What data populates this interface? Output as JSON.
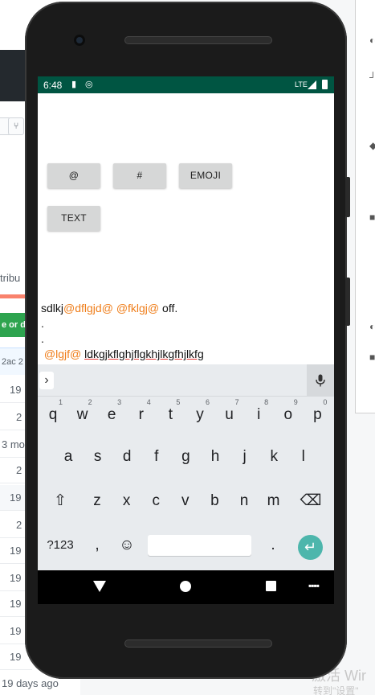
{
  "background": {
    "right_edge_text": [
      "3 mo",
      "2ac 2",
      "tribu",
      "e or do"
    ],
    "row_values": [
      "19",
      "2",
      "3 mo",
      "2",
      "19",
      "2",
      "19",
      "19",
      "19",
      "19",
      "19",
      "19 days ago"
    ],
    "watermark": "激活 Wir",
    "watermark2": "转到\"设置\""
  },
  "status_bar": {
    "time": "6:48",
    "network": "LTE"
  },
  "app": {
    "buttons": {
      "at": "@",
      "hash": "#",
      "emoji": "EMOJI",
      "text": "TEXT"
    },
    "editor_lines": [
      [
        {
          "text": "sdlkj",
          "type": "plain"
        },
        {
          "text": "@dflgjd@",
          "type": "mention"
        },
        {
          "text": " ",
          "type": "plain"
        },
        {
          "text": "@fklgj@",
          "type": "mention"
        },
        {
          "text": " off.",
          "type": "plain"
        }
      ],
      [
        {
          "text": ".",
          "type": "plain"
        }
      ],
      [
        {
          "text": ".",
          "type": "plain"
        }
      ],
      [
        {
          "text": " ",
          "type": "plain"
        },
        {
          "text": "@lgjf@",
          "type": "mention"
        },
        {
          "text": " ",
          "type": "plain"
        },
        {
          "text": "ldkgjkflghjflgkhjlkgfhjlkfg",
          "type": "misspelled"
        }
      ]
    ]
  },
  "keyboard": {
    "row1": [
      {
        "k": "q",
        "hint": "1"
      },
      {
        "k": "w",
        "hint": "2"
      },
      {
        "k": "e",
        "hint": "3"
      },
      {
        "k": "r",
        "hint": "4"
      },
      {
        "k": "t",
        "hint": "5"
      },
      {
        "k": "y",
        "hint": "6"
      },
      {
        "k": "u",
        "hint": "7"
      },
      {
        "k": "i",
        "hint": "8"
      },
      {
        "k": "o",
        "hint": "9"
      },
      {
        "k": "p",
        "hint": "0"
      }
    ],
    "row2": [
      "a",
      "s",
      "d",
      "f",
      "g",
      "h",
      "j",
      "k",
      "l"
    ],
    "row3": [
      "z",
      "x",
      "c",
      "v",
      "b",
      "n",
      "m"
    ],
    "shift": "⇧",
    "backspace": "⌫",
    "symbols": "?123",
    "comma": ",",
    "emoji": "☺",
    "period": ".",
    "enter": "↵",
    "chevron": "›",
    "mic": "🎤"
  },
  "colors": {
    "status_bar": "#005542",
    "mention": "#ef7d19",
    "misspell_underline": "#e53935",
    "enter_key": "#4db6ac"
  }
}
